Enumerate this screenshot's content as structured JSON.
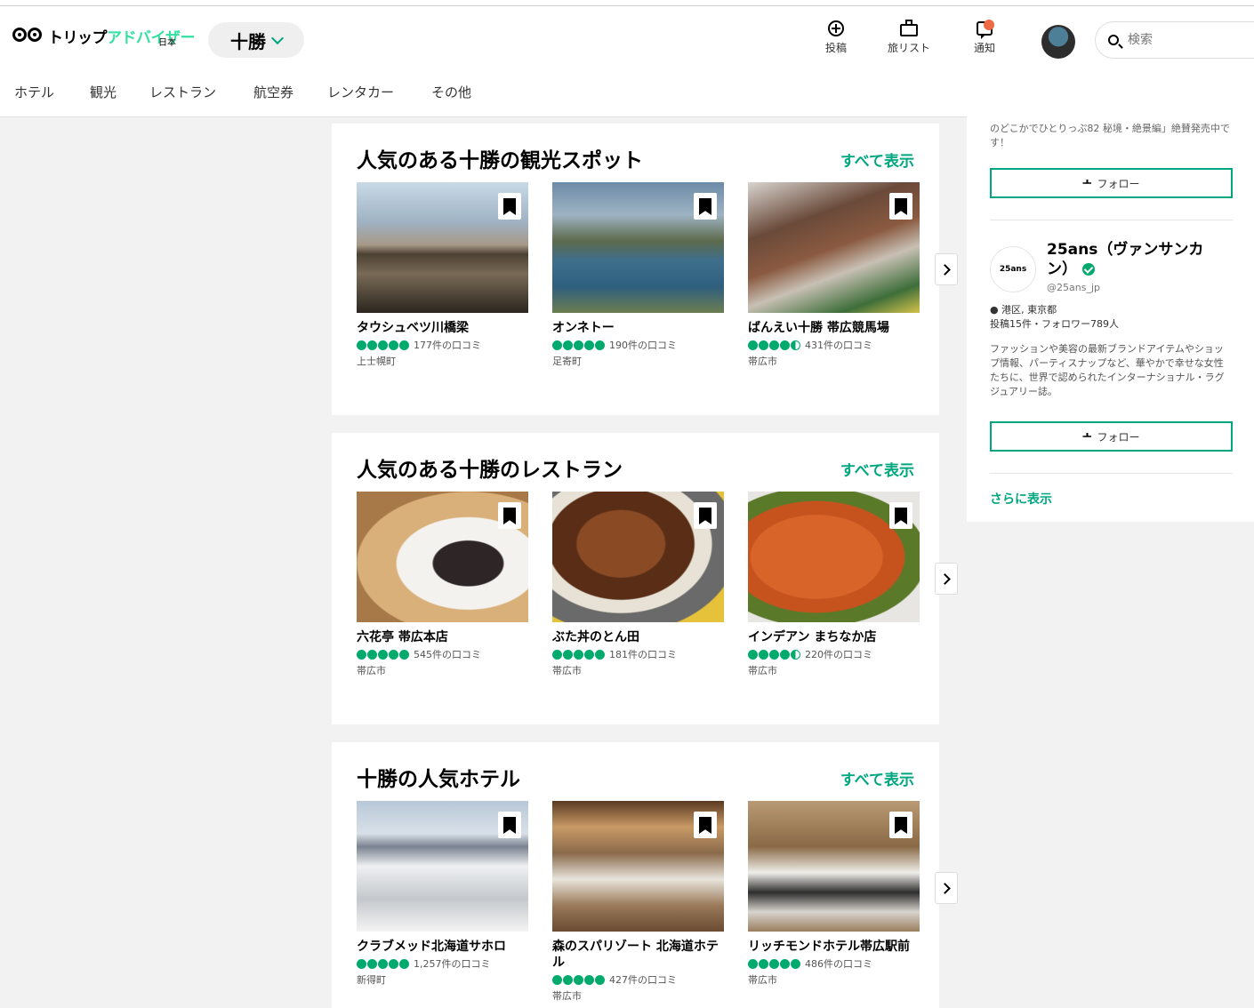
{
  "header": {
    "logo_text": "トリップアドバイザー",
    "logo_sub": "日本",
    "geo": "十勝",
    "actions": [
      {
        "label": "投稿",
        "icon": "plus-circle-icon"
      },
      {
        "label": "旅リスト",
        "icon": "briefcase-icon"
      },
      {
        "label": "通知",
        "icon": "notification-icon"
      }
    ],
    "search_placeholder": "検索"
  },
  "nav": [
    "ホテル",
    "観光",
    "レストラン",
    "航空券",
    "レンタカー",
    "その他"
  ],
  "sections": [
    {
      "title": "人気のある十勝の観光スポット",
      "see_all": "すべて表示",
      "items": [
        {
          "name": "タウシュベツ川橋梁",
          "rating": 5,
          "reviews": "177件の口コミ",
          "location": "上士幌町"
        },
        {
          "name": "オンネトー",
          "rating": 5,
          "reviews": "190件の口コミ",
          "location": "足寄町"
        },
        {
          "name": "ばんえい十勝 帯広競馬場",
          "rating": 4.5,
          "reviews": "431件の口コミ",
          "location": "帯広市"
        }
      ]
    },
    {
      "title": "人気のある十勝のレストラン",
      "see_all": "すべて表示",
      "items": [
        {
          "name": "六花亭 帯広本店",
          "rating": 5,
          "reviews": "545件の口コミ",
          "location": "帯広市"
        },
        {
          "name": "ぶた丼のとん田",
          "rating": 5,
          "reviews": "181件の口コミ",
          "location": "帯広市"
        },
        {
          "name": "インデアン まちなか店",
          "rating": 4.5,
          "reviews": "220件の口コミ",
          "location": "帯広市"
        }
      ]
    },
    {
      "title": "十勝の人気ホテル",
      "see_all": "すべて表示",
      "items": [
        {
          "name": "クラブメッド北海道サホロ",
          "rating": 5,
          "reviews": "1,257件の口コミ",
          "location": "新得町"
        },
        {
          "name": "森のスパリゾート 北海道ホテル",
          "rating": 5,
          "reviews": "427件の口コミ",
          "location": "帯広市"
        },
        {
          "name": "リッチモンドホテル帯広駅前",
          "rating": 5,
          "reviews": "486件の口コミ",
          "location": "帯広市"
        }
      ]
    }
  ],
  "sidebar": {
    "top_text": "のどこかでひとりっぷ82 秘境・絶景編」絶賛発売中です！",
    "follow_label": "フォロー",
    "account_name": "25ans（ヴァンサンカン）",
    "account_logo": "25ans",
    "handle": "@25ans_jp",
    "location": "港区, 東京都",
    "stats": "投稿15件・フォロワー789人",
    "bio": "ファッションや美容の最新ブランドアイテムやショップ情報、パーティスナップなど、華やかで幸せな女性たちに、世界で認められたインターナショナル・ラグジュアリー誌。",
    "more": "さらに表示"
  }
}
